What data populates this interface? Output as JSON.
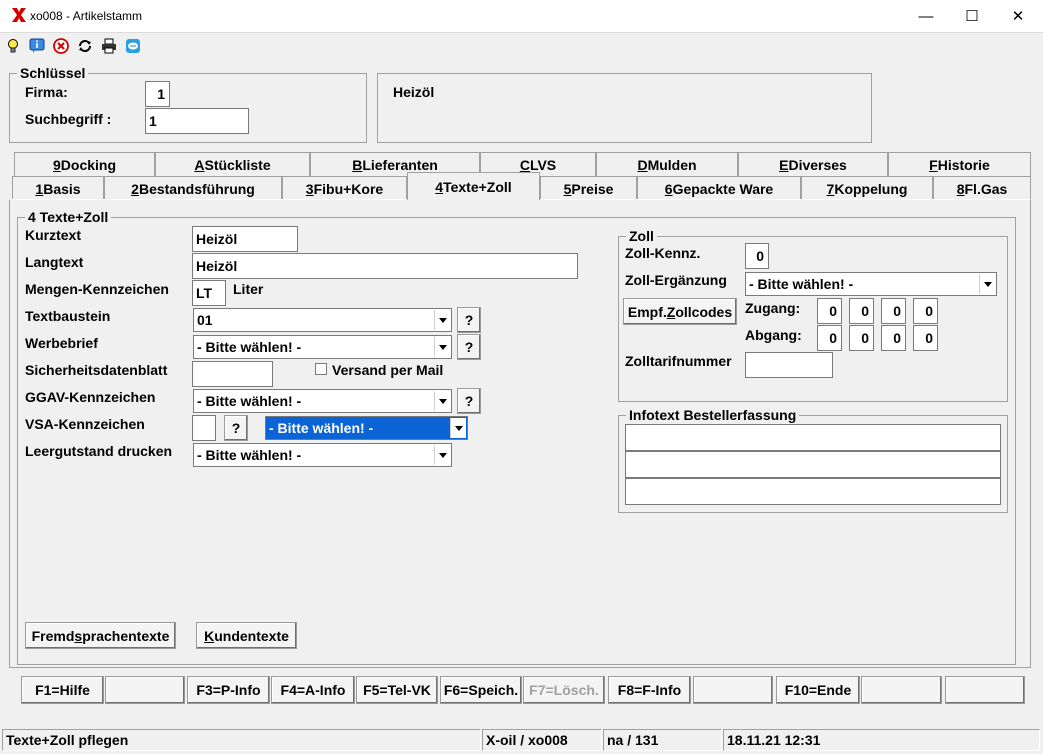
{
  "window": {
    "title": "xo008 - Artikelstamm",
    "minimize": "—",
    "maximize": "☐",
    "close": "✕"
  },
  "toolbar": {
    "icons": [
      "lightbulb-icon",
      "info-icon",
      "cancel-icon",
      "refresh-icon",
      "print-icon",
      "chat-icon"
    ]
  },
  "key": {
    "legend": "Schlüssel",
    "firma_label": "Firma:",
    "firma_value": "1",
    "suchbegriff_label": "Suchbegriff :",
    "suchbegriff_value": "1",
    "name": "Heizöl"
  },
  "tabs_row1": [
    {
      "hot": "9",
      "rest": " Docking"
    },
    {
      "hot": "A",
      "rest": " Stückliste"
    },
    {
      "hot": "B",
      "rest": " Lieferanten"
    },
    {
      "hot": "C",
      "rest": " LVS"
    },
    {
      "hot": "D",
      "rest": " Mulden"
    },
    {
      "hot": "E",
      "rest": " Diverses"
    },
    {
      "hot": "F",
      "rest": " Historie"
    }
  ],
  "tabs_row2": [
    {
      "hot": "1",
      "rest": " Basis"
    },
    {
      "hot": "2",
      "rest": " Bestandsführung"
    },
    {
      "hot": "3",
      "rest": " Fibu+Kore"
    },
    {
      "hot": "4",
      "rest": " Texte+Zoll"
    },
    {
      "hot": "5",
      "rest": " Preise"
    },
    {
      "hot": "6",
      "rest": " Gepackte Ware"
    },
    {
      "hot": "7",
      "rest": " Koppelung"
    },
    {
      "hot": "8",
      "rest": " Fl.Gas"
    }
  ],
  "main": {
    "legend": "4 Texte+Zoll",
    "kurztext_label": "Kurztext",
    "kurztext_value": "Heizöl",
    "langtext_label": "Langtext",
    "langtext_value": "Heizöl",
    "mengen_label": "Mengen-Kennzeichen",
    "mengen_value": "LT",
    "mengen_unit": "Liter",
    "textbaustein_label": "Textbaustein",
    "textbaustein_value": "01",
    "werbebrief_label": "Werbebrief",
    "werbebrief_value": "- Bitte wählen! -",
    "sdb_label": "Sicherheitsdatenblatt",
    "sdb_value": "",
    "versand_label": "Versand per Mail",
    "ggav_label": "GGAV-Kennzeichen",
    "ggav_value": "- Bitte wählen! -",
    "vsa_label": "VSA-Kennzeichen",
    "vsa_value": "",
    "vsa_combo_value": "- Bitte wählen! -",
    "leergut_label": "Leergutstand drucken",
    "leergut_value": "- Bitte wählen! -",
    "help_btn": "?",
    "fremd_btn_pre": "Fremd",
    "fremd_btn_hot": "s",
    "fremd_btn_post": "prachentexte",
    "kunden_btn_hot": "K",
    "kunden_btn_post": "undentexte"
  },
  "zoll": {
    "legend": "Zoll",
    "kennz_label": "Zoll-Kennz.",
    "kennz_value": "0",
    "ergaenzung_label": "Zoll-Ergänzung",
    "ergaenzung_value": "- Bitte wählen! -",
    "empf_pre": "Empf.",
    "empf_hot": "Z",
    "empf_post": "ollcodes",
    "zugang_label": "Zugang:",
    "zugang_values": [
      "0",
      "0",
      "0",
      "0"
    ],
    "abgang_label": "Abgang:",
    "abgang_values": [
      "0",
      "0",
      "0",
      "0"
    ],
    "tarif_label": "Zolltarifnummer",
    "tarif_value": ""
  },
  "infotext": {
    "legend": "Infotext Bestellerfassung",
    "lines": [
      "",
      "",
      ""
    ]
  },
  "fkeys": [
    "F1=Hilfe",
    "",
    "F3=P-Info",
    "F4=A-Info",
    "F5=Tel-VK",
    "F6=Speich.",
    "F7=Lösch.",
    "F8=F-Info",
    "",
    "F10=Ende",
    "",
    ""
  ],
  "status": {
    "message": "Texte+Zoll pflegen",
    "system": "X-oil / xo008",
    "user": "na / 131",
    "datetime": "18.11.21 12:31"
  }
}
